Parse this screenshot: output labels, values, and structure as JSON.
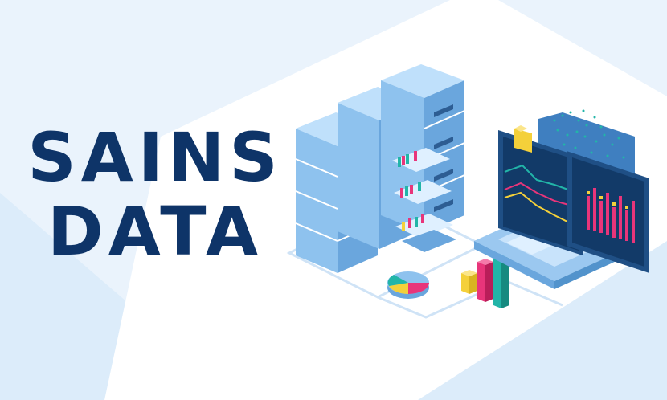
{
  "title": {
    "line1": "SAINS",
    "line2": "DATA"
  },
  "colors": {
    "background": "#eaf3fc",
    "title": "#0e3468",
    "server": "#8ec2ee",
    "accent_teal": "#22b5a8",
    "accent_pink": "#e8357a",
    "accent_yellow": "#f4d03a"
  },
  "icons": [
    "server-rack-icon",
    "file-drawer-icon",
    "pie-chart-icon",
    "bar-chart-icon",
    "laptop-icon",
    "monitor-icon",
    "folder-icon"
  ]
}
